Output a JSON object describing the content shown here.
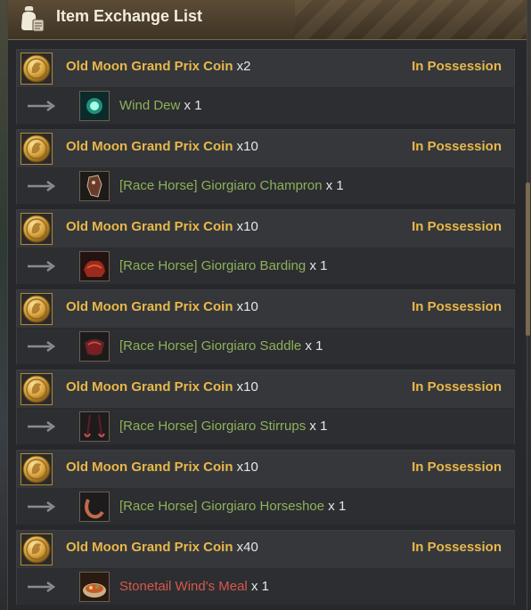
{
  "window": {
    "title": "Item Exchange List",
    "title_icon": "bag-scroll-icon"
  },
  "colors": {
    "cost_name": "#e8b84a",
    "reward_green": "#8fb05a",
    "reward_red": "#d9574a",
    "status": "#e8b84a"
  },
  "entries": [
    {
      "cost_item": "Old Moon Grand Prix Coin",
      "cost_qty": "x2",
      "status": "In Possession",
      "reward_item": "Wind Dew",
      "reward_qty": "x 1",
      "reward_icon": "wind-dew-icon",
      "reward_color": "green"
    },
    {
      "cost_item": "Old Moon Grand Prix Coin",
      "cost_qty": "x10",
      "status": "In Possession",
      "reward_item": "[Race Horse] Giorgiaro Champron",
      "reward_qty": "x 1",
      "reward_icon": "champron-icon",
      "reward_color": "green"
    },
    {
      "cost_item": "Old Moon Grand Prix Coin",
      "cost_qty": "x10",
      "status": "In Possession",
      "reward_item": "[Race Horse] Giorgiaro Barding",
      "reward_qty": "x 1",
      "reward_icon": "barding-icon",
      "reward_color": "green"
    },
    {
      "cost_item": "Old Moon Grand Prix Coin",
      "cost_qty": "x10",
      "status": "In Possession",
      "reward_item": "[Race Horse] Giorgiaro Saddle",
      "reward_qty": "x 1",
      "reward_icon": "saddle-icon",
      "reward_color": "green"
    },
    {
      "cost_item": "Old Moon Grand Prix Coin",
      "cost_qty": "x10",
      "status": "In Possession",
      "reward_item": "[Race Horse] Giorgiaro Stirrups",
      "reward_qty": "x 1",
      "reward_icon": "stirrups-icon",
      "reward_color": "green"
    },
    {
      "cost_item": "Old Moon Grand Prix Coin",
      "cost_qty": "x10",
      "status": "In Possession",
      "reward_item": "[Race Horse] Giorgiaro Horseshoe",
      "reward_qty": "x 1",
      "reward_icon": "horseshoe-icon",
      "reward_color": "green"
    },
    {
      "cost_item": "Old Moon Grand Prix Coin",
      "cost_qty": "x40",
      "status": "In Possession",
      "reward_item": "Stonetail Wind's Meal",
      "reward_qty": "x 1",
      "reward_icon": "meal-icon",
      "reward_color": "red"
    }
  ]
}
